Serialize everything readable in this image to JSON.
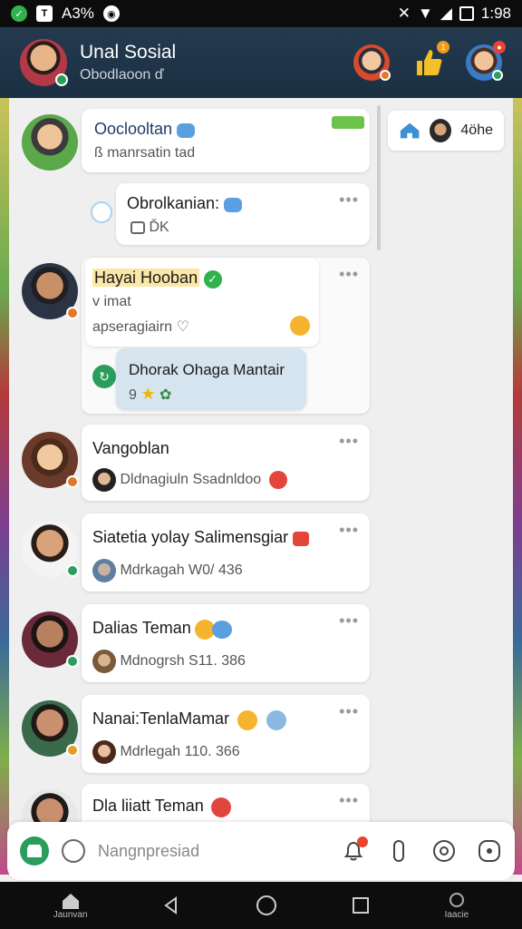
{
  "status_bar": {
    "left_text": "A3%",
    "time": "1:98",
    "icons": [
      "whatsapp-icon",
      "app-icon",
      "notification-icon",
      "mute-icon",
      "wifi-icon",
      "signal-icon",
      "battery-icon"
    ]
  },
  "header": {
    "title": "Unal Sosial",
    "subtitle": "Obodlaoon ď",
    "actions": [
      "profile-icon",
      "like-icon",
      "user-icon"
    ]
  },
  "side_chip": {
    "label": "4öhe"
  },
  "posts": [
    {
      "name": "Ooclooltan",
      "meta": "ß manrsatin tad"
    },
    {
      "name": "Obrolkanian:",
      "meta": "ĎK"
    },
    {
      "name": "Hayai Hooban",
      "meta_line1": "v imat",
      "meta_line2": "apseragiairn ♡"
    },
    {
      "name": "Dhorak Ohaga Mantair",
      "meta": "9"
    },
    {
      "name": "Vangoblan",
      "meta": "Dldnagiuln Ssadnldoo"
    },
    {
      "name": "Siatetia yolay Salimensgiar",
      "meta": "Mdrkagah W0/ 436"
    },
    {
      "name": "Dalias Teman",
      "meta": "Mdnogrsh S11. 386"
    },
    {
      "name": "Nanai:TenlaMamar",
      "meta": "Mdrlegah 110. 366"
    },
    {
      "name": "Dla liiatt Teman"
    }
  ],
  "more_label": "•••",
  "composer": {
    "placeholder": "Nangnpresiad"
  },
  "navbar": {
    "home_label": "Jaunvan",
    "assistant_label": "Iaacie"
  },
  "colors": {
    "header_bg": "#1f3447",
    "accent_green": "#2a9d5c",
    "badge_orange": "#e8432f"
  }
}
